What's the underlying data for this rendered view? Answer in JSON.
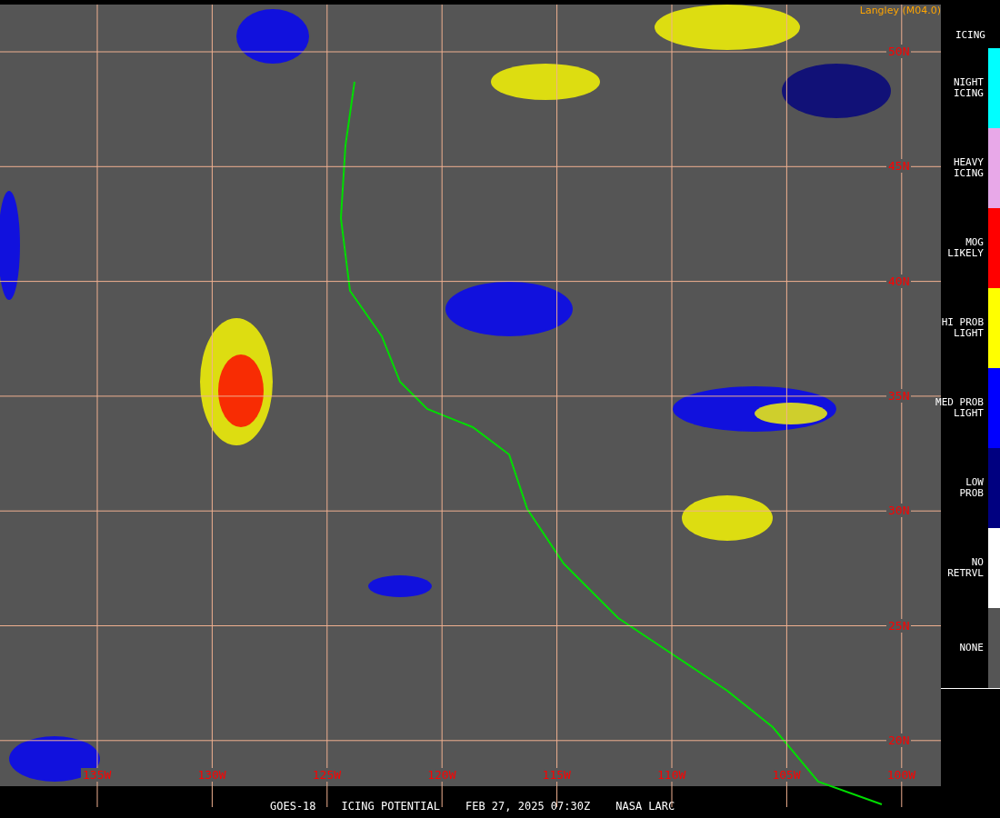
{
  "map": {
    "credit": "Langley (M04.0)",
    "latitudes": [
      "50N",
      "45N",
      "40N",
      "35N",
      "30N",
      "25N",
      "20N"
    ],
    "longitudes": [
      "135W",
      "130W",
      "125W",
      "120W",
      "115W",
      "110W",
      "105W",
      "100W"
    ]
  },
  "legend": {
    "title": "ICING",
    "items": [
      {
        "lines": [
          "NIGHT",
          "ICING"
        ],
        "color": "#00ffff"
      },
      {
        "lines": [
          "HEAVY",
          "ICING"
        ],
        "color": "#e8a8e8"
      },
      {
        "lines": [
          "MOG",
          "LIKELY"
        ],
        "color": "#ff0000"
      },
      {
        "lines": [
          "HI PROB",
          "LIGHT"
        ],
        "color": "#ffff00"
      },
      {
        "lines": [
          "MED PROB",
          "LIGHT"
        ],
        "color": "#0000ff"
      },
      {
        "lines": [
          "LOW",
          "PROB"
        ],
        "color": "#000080"
      },
      {
        "lines": [
          "NO",
          "RETRVL"
        ],
        "color": "#ffffff"
      },
      {
        "lines": [
          "NONE"
        ],
        "color": "#555555"
      }
    ]
  },
  "caption": [
    "GOES-18",
    "ICING POTENTIAL",
    "FEB 27, 2025 07:30Z",
    "NASA LARC"
  ]
}
